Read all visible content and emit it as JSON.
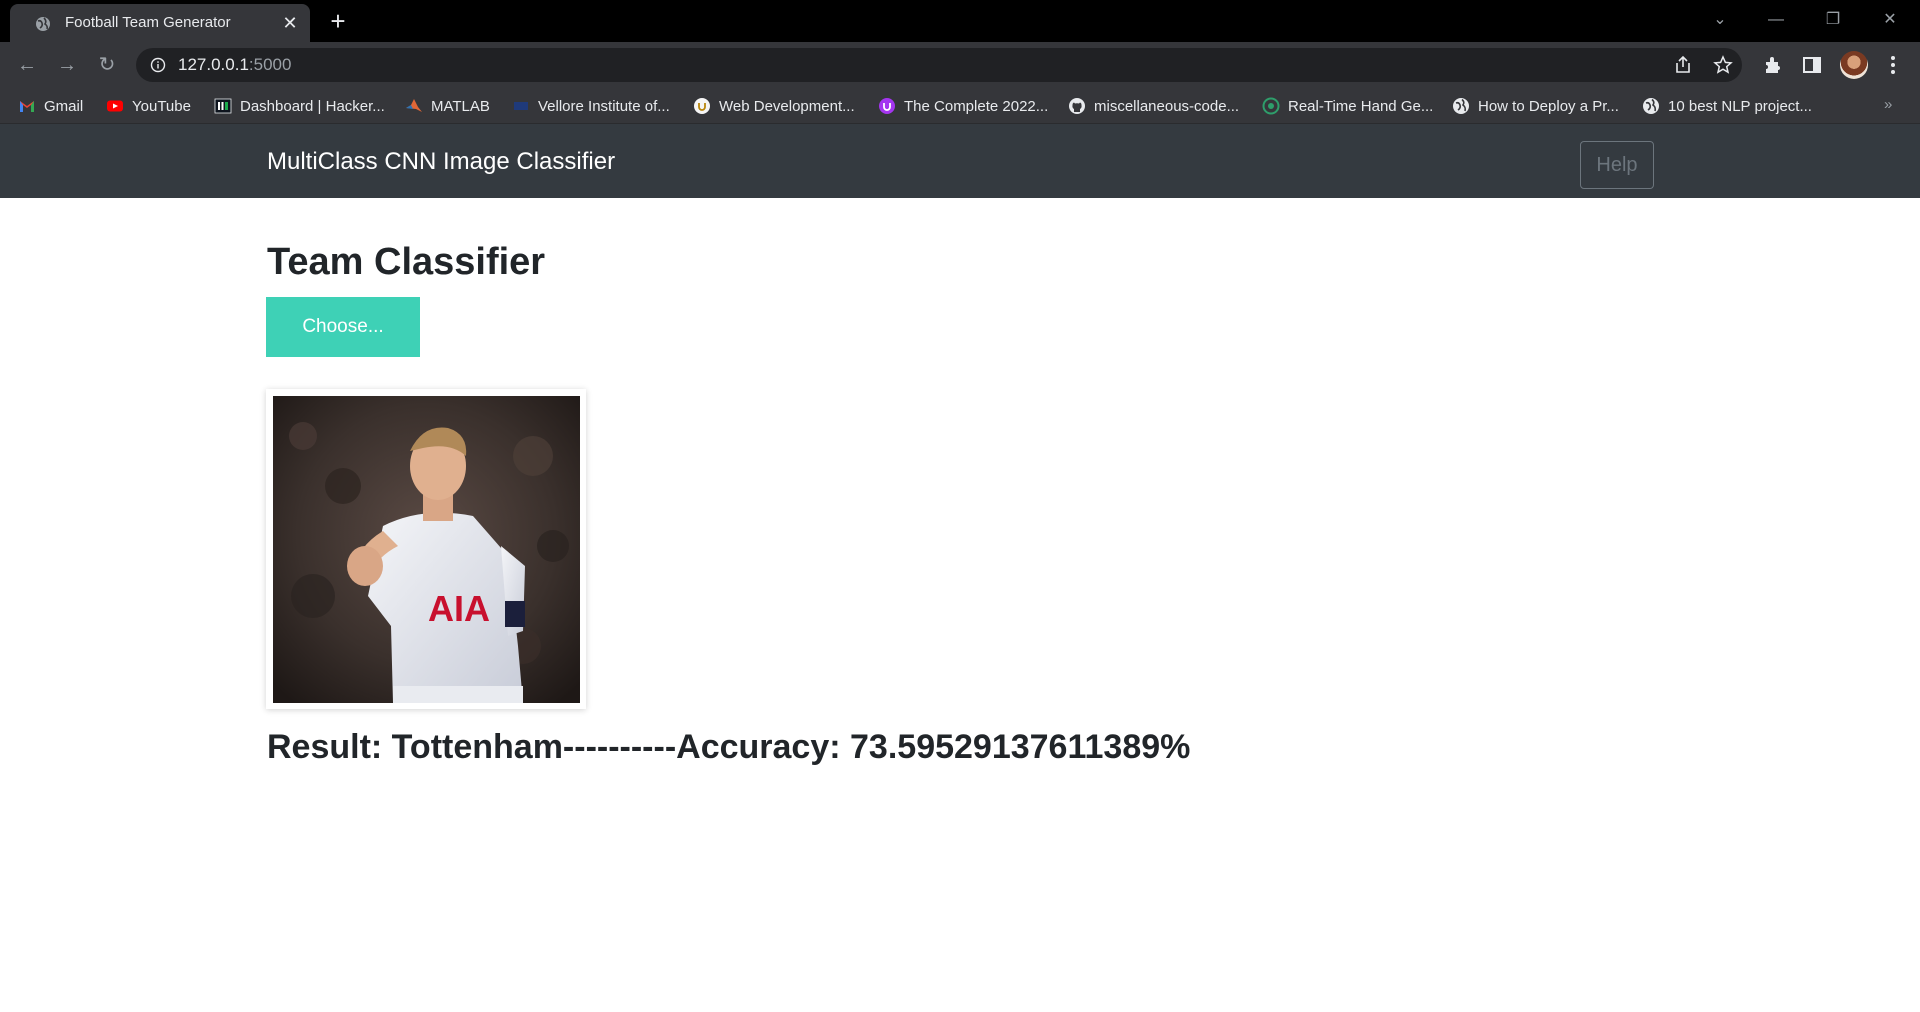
{
  "browser": {
    "tab_title": "Football Team Generator",
    "url_host": "127.0.0.1",
    "url_port": ":5000",
    "bookmarks": [
      {
        "label": "Gmail",
        "icon": "gmail-icon"
      },
      {
        "label": "YouTube",
        "icon": "youtube-icon"
      },
      {
        "label": "Dashboard | Hacker...",
        "icon": "hackerrank-icon"
      },
      {
        "label": "MATLAB",
        "icon": "matlab-icon"
      },
      {
        "label": "Vellore Institute of...",
        "icon": "vit-icon"
      },
      {
        "label": "Web Development...",
        "icon": "udemy-icon"
      },
      {
        "label": "The Complete 2022...",
        "icon": "udemy-purple-icon"
      },
      {
        "label": "miscellaneous-code...",
        "icon": "github-icon"
      },
      {
        "label": "Real-Time Hand Ge...",
        "icon": "globe-green-icon"
      },
      {
        "label": "How to Deploy a Pr...",
        "icon": "globe-icon"
      },
      {
        "label": "10 best NLP project...",
        "icon": "globe-icon"
      }
    ],
    "more_bookmarks": "»"
  },
  "navbar": {
    "brand": "MultiClass CNN Image Classifier",
    "help_label": "Help"
  },
  "main": {
    "title": "Team Classifier",
    "choose_label": "Choose...",
    "result_text": "Result: Tottenham----------Accuracy: 73.59529137611389%"
  },
  "colors": {
    "navbar_bg": "#343a40",
    "choose_button_bg": "#3ed1b6",
    "chrome_bg": "#35363a"
  }
}
